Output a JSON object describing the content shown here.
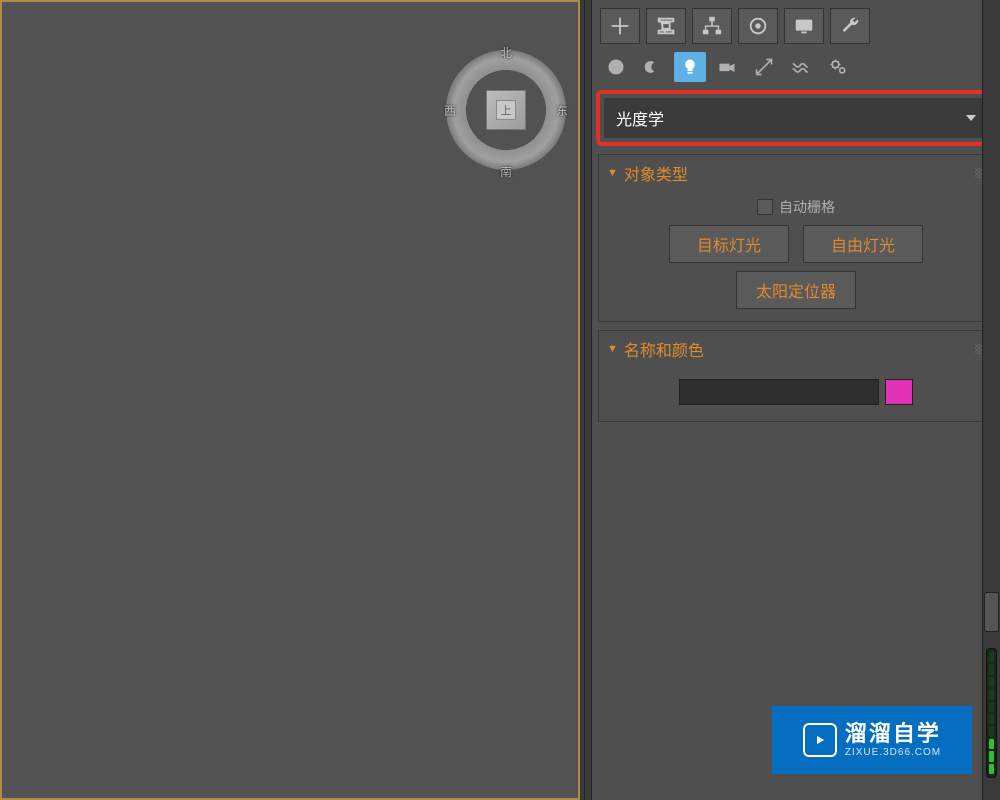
{
  "viewcube": {
    "north": "北",
    "south": "南",
    "east": "东",
    "west": "西",
    "face": "上"
  },
  "toolbar": {
    "create_icon": "plus-icon",
    "modify_icon": "modify-icon",
    "hierarchy_icon": "hierarchy-icon",
    "motion_icon": "motion-icon",
    "display_icon": "display-icon",
    "utilities_icon": "wrench-icon"
  },
  "categories": {
    "geometry": "sphere-icon",
    "shapes": "shapes-icon",
    "lights": "bulb-icon",
    "cameras": "camera-icon",
    "helpers": "helper-icon",
    "spacewarp": "wave-icon",
    "systems": "gear-icon"
  },
  "dropdown": {
    "selected": "光度学"
  },
  "rollouts": {
    "object_type": {
      "title": "对象类型",
      "autogrid_label": "自动栅格",
      "buttons": [
        "目标灯光",
        "自由灯光",
        "太阳定位器"
      ]
    },
    "name_color": {
      "title": "名称和颜色",
      "name_value": "",
      "color": "#e032b5"
    }
  },
  "watermark": {
    "title": "溜溜自学",
    "subtitle": "ZIXUE.3D66.COM"
  }
}
